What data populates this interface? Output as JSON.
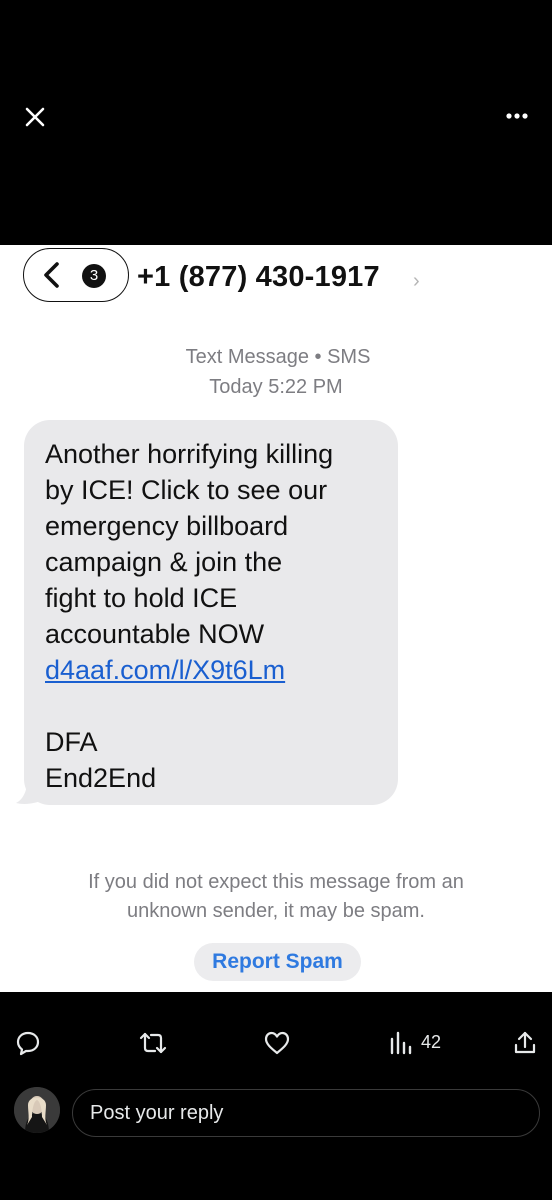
{
  "viewer": {
    "close_icon": "close-icon",
    "more_icon": "more-horizontal-icon"
  },
  "imessage": {
    "back_count": "3",
    "contact_name": "+1 (877) 430-1917",
    "meta_line1": "Text Message • SMS",
    "meta_line2": "Today 5:22 PM",
    "message": {
      "lines": [
        "Another horrifying killing",
        "by ICE! Click to see our",
        "emergency billboard",
        "campaign & join the",
        "fight to hold ICE",
        "accountable NOW"
      ],
      "link": "d4aaf.com/l/X9t6Lm",
      "signature_1": "DFA",
      "signature_2": "End2End"
    },
    "spam_note_1": "If you did not expect this message from an",
    "spam_note_2": "unknown sender, it may be spam.",
    "report_spam": "Report Spam",
    "link_color": "#1a5fd0",
    "report_color": "#2f7ae0"
  },
  "post_actions": {
    "views": "42",
    "icons": [
      "reply-icon",
      "repost-icon",
      "like-icon",
      "views-icon",
      "share-icon"
    ]
  },
  "reply": {
    "placeholder": "Post your reply"
  }
}
